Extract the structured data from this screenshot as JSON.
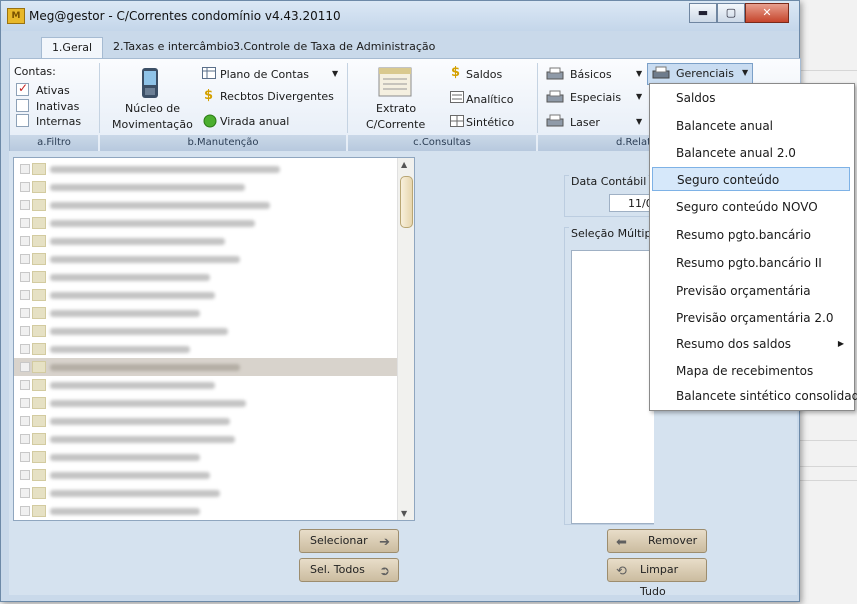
{
  "window": {
    "title": "Meg@gestor - C/Correntes condomínio v4.43.20110",
    "icon": "M",
    "buttons": {
      "minimize": "▬",
      "maximize": "▢",
      "close": "✕"
    }
  },
  "tabs": [
    {
      "label": "1.Geral"
    },
    {
      "label": "2.Taxas e intercâmbio"
    },
    {
      "label": "3.Controle de Taxa de Administração"
    }
  ],
  "ribbon": {
    "filtro": {
      "title": "Contas:",
      "items": [
        {
          "label": "Ativas",
          "checked": true
        },
        {
          "label": "Inativas",
          "checked": false
        },
        {
          "label": "Internas",
          "checked": false
        }
      ],
      "group_label": "a.Filtro"
    },
    "manutencao": {
      "big_button": {
        "line1": "Núcleo de",
        "line2": "Movimentação"
      },
      "items": [
        {
          "label": "Plano de Contas",
          "icon": "table-icon"
        },
        {
          "label": "Recbtos Divergentes",
          "icon": "dollar-icon"
        },
        {
          "label": "Virada anual",
          "icon": "refresh-icon"
        }
      ],
      "group_label": "b.Manutenção"
    },
    "consultas": {
      "big_button": {
        "line1": "Extrato",
        "line2": "C/Corrente"
      },
      "items": [
        {
          "label": "Saldos",
          "icon": "dollar-icon"
        },
        {
          "label": "Analítico",
          "icon": "list-icon"
        },
        {
          "label": "Sintético",
          "icon": "grid-icon"
        }
      ],
      "group_label": "c.Consultas"
    },
    "relatorios": {
      "items": [
        {
          "label": "Básicos",
          "icon": "printer-icon"
        },
        {
          "label": "Especiais",
          "icon": "printer-icon"
        },
        {
          "label": "Laser",
          "icon": "printer-icon"
        },
        {
          "label": "Gerenciais",
          "icon": "printer-icon"
        }
      ],
      "group_label": "d.Relat"
    }
  },
  "main": {
    "data_contabil": {
      "label": "Data Contábil",
      "value": "11/0"
    },
    "selecao_multipla": {
      "label": "Seleção Múltipla"
    },
    "buttons": {
      "selecionar": "Selecionar",
      "sel_todos": "Sel. Todos",
      "remover": "Remover",
      "limpar_tudo": "Limpar Tudo"
    }
  },
  "menu": {
    "items": [
      {
        "label": "Saldos"
      },
      {
        "label": "Balancete anual"
      },
      {
        "label": "Balancete anual 2.0"
      },
      {
        "label": "Seguro conteúdo",
        "highlighted": true
      },
      {
        "label": "Seguro conteúdo NOVO"
      },
      {
        "label": "Resumo pgto.bancário"
      },
      {
        "label": "Resumo pgto.bancário II"
      },
      {
        "label": "Previsão orçamentária"
      },
      {
        "label": "Previsão orçamentária 2.0"
      },
      {
        "label": "Resumo dos saldos",
        "submenu": true
      },
      {
        "label": "Mapa de recebimentos"
      },
      {
        "label": "Balancete sintético consolidado"
      }
    ]
  },
  "colors": {
    "accent": "#7eb2e6",
    "ribbon_group": "#b7c9de",
    "window": "#c9d9ea"
  }
}
